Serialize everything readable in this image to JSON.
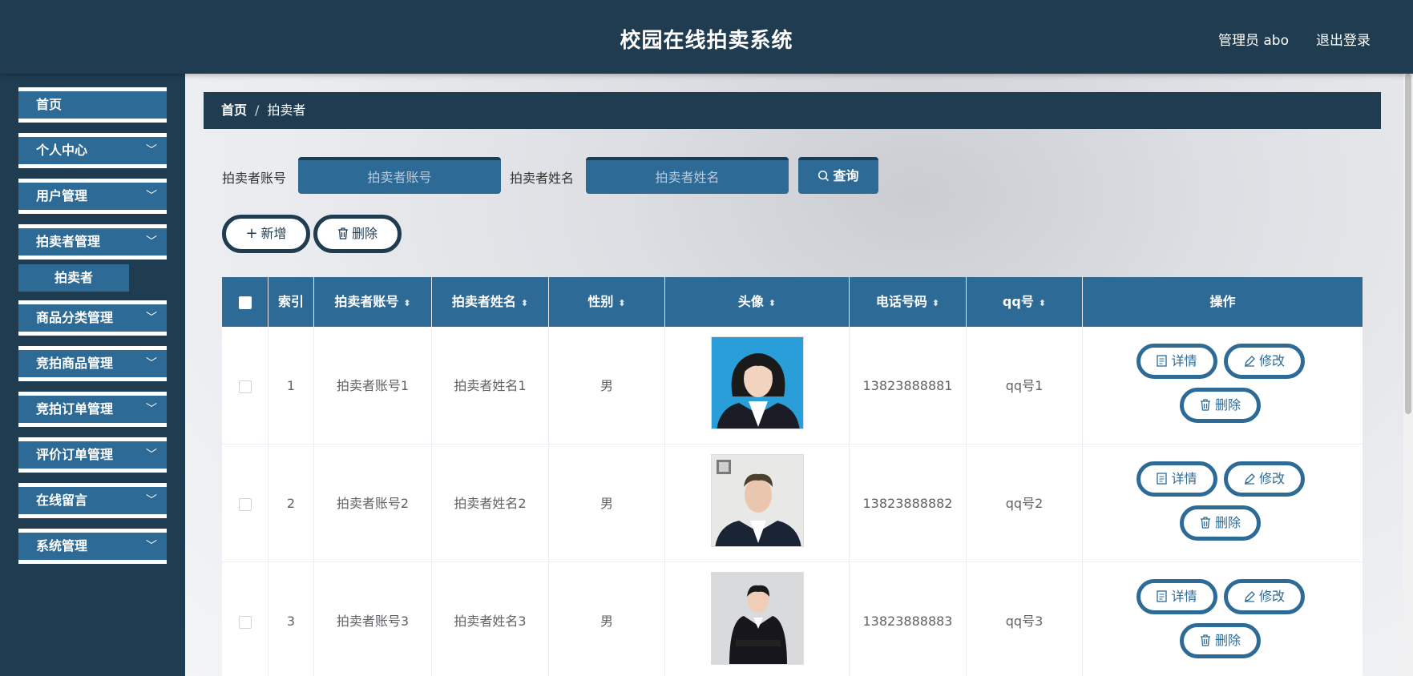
{
  "header": {
    "title": "校园在线拍卖系统",
    "user": "管理员 abo",
    "logout": "退出登录"
  },
  "sidebar": {
    "items": [
      {
        "label": "首页",
        "chevron": ""
      },
      {
        "label": "个人中心",
        "chevron": "﹀"
      },
      {
        "label": "用户管理",
        "chevron": "﹀"
      },
      {
        "label": "拍卖者管理",
        "chevron": "﹀"
      },
      {
        "label": "商品分类管理",
        "chevron": "﹀"
      },
      {
        "label": "竞拍商品管理",
        "chevron": "﹀"
      },
      {
        "label": "竞拍订单管理",
        "chevron": "﹀"
      },
      {
        "label": "评价订单管理",
        "chevron": "﹀"
      },
      {
        "label": "在线留言",
        "chevron": "﹀"
      },
      {
        "label": "系统管理",
        "chevron": "﹀"
      }
    ],
    "sub_item": "拍卖者"
  },
  "breadcrumb": {
    "home": "首页",
    "separator": "/",
    "current": "拍卖者"
  },
  "search": {
    "account_label": "拍卖者账号",
    "account_placeholder": "拍卖者账号",
    "name_label": "拍卖者姓名",
    "name_placeholder": "拍卖者姓名",
    "query_button": "查询",
    "query_icon": "search-icon"
  },
  "toolbar": {
    "add_button": "新增",
    "delete_button": "删除"
  },
  "table": {
    "columns": [
      "索引",
      "拍卖者账号",
      "拍卖者姓名",
      "性别",
      "头像",
      "电话号码",
      "qq号",
      "操作"
    ],
    "rows": [
      {
        "index": "1",
        "account": "拍卖者账号1",
        "name": "拍卖者姓名1",
        "gender": "男",
        "phone": "13823888881",
        "qq": "qq号1"
      },
      {
        "index": "2",
        "account": "拍卖者账号2",
        "name": "拍卖者姓名2",
        "gender": "男",
        "phone": "13823888882",
        "qq": "qq号2"
      },
      {
        "index": "3",
        "account": "拍卖者账号3",
        "name": "拍卖者姓名3",
        "gender": "男",
        "phone": "13823888883",
        "qq": "qq号3"
      }
    ],
    "actions": {
      "detail": "详情",
      "edit": "修改",
      "delete": "删除"
    }
  },
  "colors": {
    "header_bg": "#1f3c51",
    "accent": "#2d6a95",
    "text": "#606266"
  }
}
